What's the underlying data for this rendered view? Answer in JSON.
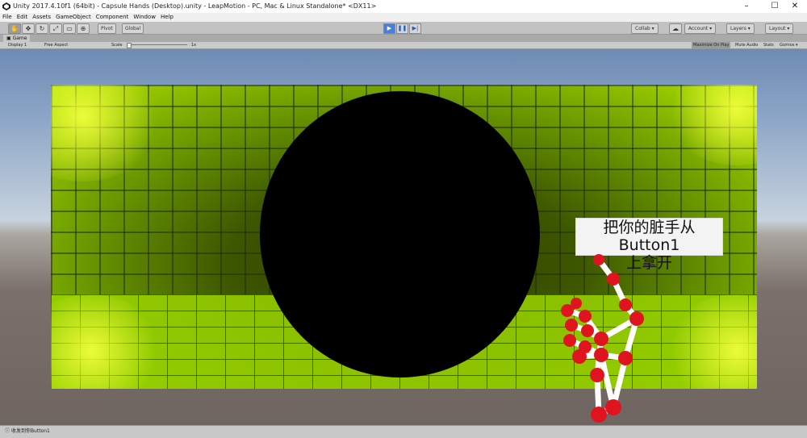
{
  "window": {
    "title": "Unity 2017.4.10f1 (64bit) - Capsule Hands (Desktop).unity - LeapMotion - PC, Mac & Linux Standalone* <DX11>",
    "controls": [
      "–",
      "☐",
      "✕"
    ]
  },
  "menu": [
    "File",
    "Edit",
    "Assets",
    "GameObject",
    "Component",
    "Window",
    "Help"
  ],
  "toolbar": {
    "tools": [
      "hand-tool",
      "move-tool",
      "rotate-tool",
      "scale-tool",
      "rect-tool",
      "transform-tool"
    ],
    "pivot": "Pivot",
    "global": "Global",
    "collab": "Collab ▾",
    "account": "Account ▾",
    "layers": "Layers",
    "layout": "Layout"
  },
  "game_panel": {
    "tab": "Game",
    "display": "Display 1",
    "aspect": "Free Aspect",
    "scale_label": "Scale",
    "scale_value": "1x",
    "maximize": "Maximize On Play",
    "mute": "Mute Audio",
    "stats": "Stats",
    "gizmos": "Gizmos ▾"
  },
  "scene": {
    "button_line1": "把你的脏手从 Button1",
    "button_line2": "上拿开"
  },
  "statusbar": {
    "message": "收发到你Button1"
  },
  "colors": {
    "accent_play": "#4a7fd4",
    "hand_joint": "#e0141e",
    "hand_bone": "#ffffff"
  }
}
